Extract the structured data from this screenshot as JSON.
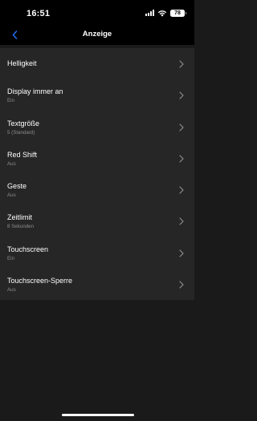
{
  "status_bar": {
    "time": "16:51",
    "battery": "78"
  },
  "header": {
    "title": "Anzeige",
    "back_icon": "chevron-left-icon",
    "accent_color": "#1f6ff2"
  },
  "items": [
    {
      "title": "Helligkeit",
      "subtitle": ""
    },
    {
      "title": "Display immer an",
      "subtitle": "Ein"
    },
    {
      "title": "Textgröße",
      "subtitle": "5 (Standard)"
    },
    {
      "title": "Red Shift",
      "subtitle": "Aus"
    },
    {
      "title": "Geste",
      "subtitle": "Aus"
    },
    {
      "title": "Zeitlimit",
      "subtitle": "8 Sekunden"
    },
    {
      "title": "Touchscreen",
      "subtitle": "Ein"
    },
    {
      "title": "Touchscreen-Sperre",
      "subtitle": "Aus"
    }
  ],
  "item_icon": "chevron-right-icon"
}
